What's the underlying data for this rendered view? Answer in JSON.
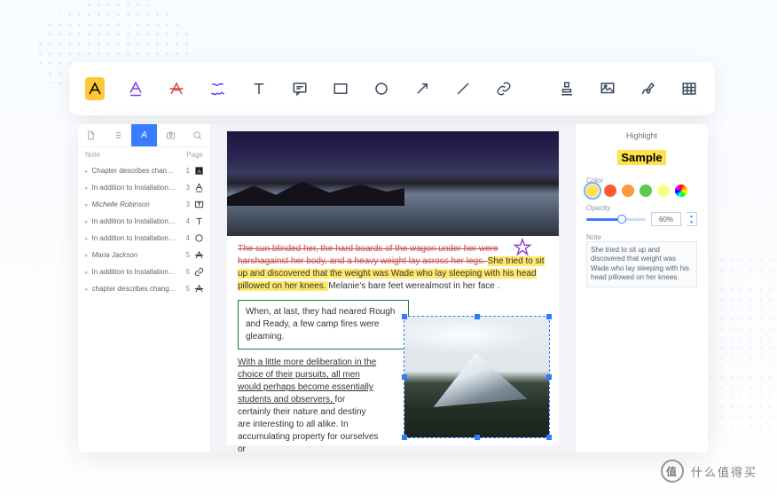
{
  "sidebar": {
    "header": {
      "note": "Note",
      "page": "Page"
    },
    "items": [
      {
        "text": "Chapter describes change Sho…",
        "page": "1",
        "icon": "highlight"
      },
      {
        "text": "In addition to Installation instru…",
        "page": "3",
        "icon": "underline"
      },
      {
        "text": "Michelle Robinson",
        "page": "3",
        "icon": "text-box",
        "em": true
      },
      {
        "text": "In addition to Installation instru…",
        "page": "4",
        "icon": "text"
      },
      {
        "text": "In addition to Installation instru…",
        "page": "4",
        "icon": "circle"
      },
      {
        "text": "Maria Jackson",
        "page": "5",
        "icon": "strike",
        "em": true
      },
      {
        "text": "In addition to Installation instru…",
        "page": "5",
        "icon": "link"
      },
      {
        "text": "chapter describes change Sho…",
        "page": "5",
        "icon": "strike"
      }
    ]
  },
  "document": {
    "struck": "The sun blinded her, the hard boards of the wagon under her were harshagainst her body, and a heavy weight lay across her legs. ",
    "highlighted": "She tried to sit up and discovered that the weight was Wade who lay sleeping with his head pillowed on her knees. ",
    "plain1": "Melanie's bare feet werealmost in her face .",
    "boxed": "When, at last, they had neared Rough and Ready, a few camp fires were gleaming.",
    "underlined": "With a little more deliberation in the choice of their pursuits, all men would perhaps become essentially students and observers, ",
    "plain2": "for certainly their nature and destiny are interesting to all alike. In accumulating property for ourselves or"
  },
  "panel": {
    "title": "Highlight",
    "sample": "Sample",
    "color_label": "Color",
    "colors": [
      "#ffe14d",
      "#ff5a36",
      "#ff9a3c",
      "#5ec94e",
      "#f7ff8a",
      "rainbow"
    ],
    "selected_color": 0,
    "opacity_label": "Opacity",
    "opacity_value": "60%",
    "note_label": "Note",
    "note_text": "She tried to sit up and discovered that weight was Wade who lay sleeping with his head pillowed on her knees."
  },
  "watermark": {
    "badge": "值",
    "text": "什么值得买"
  },
  "note_icons_svg": {
    "highlight": "<svg width='11' height='11' viewBox='0 0 24 24'><rect x='3' y='3' width='18' height='18' fill='#222'/><text x='12' y='17' font-size='14' fill='#fff' text-anchor='middle' font-family='serif'>A</text></svg>",
    "underline": "<svg width='11' height='11' viewBox='0 0 24 24' fill='none' stroke='#333' stroke-width='2'><path d='M4 18 L12 3 L20 18 M7 12 H17 M4 22 H20'/></svg>",
    "text-box": "<svg width='11' height='11' viewBox='0 0 24 24' fill='none' stroke='#333' stroke-width='2'><rect x='3' y='5' width='18' height='14'/><path d='M8 8h8M12 8v8'/></svg>",
    "text": "<svg width='11' height='11' viewBox='0 0 24 24' fill='none' stroke='#333' stroke-width='2'><path d='M5 5 H19 M12 5 V20'/></svg>",
    "circle": "<svg width='11' height='11' viewBox='0 0 24 24' fill='none' stroke='#333' stroke-width='2'><circle cx='12' cy='12' r='8'/></svg>",
    "strike": "<svg width='11' height='11' viewBox='0 0 24 24' fill='none' stroke='#333' stroke-width='2'><path d='M4 20 L12 4 L20 20 M7 14 H17 M2 12 H22'/></svg>",
    "link": "<svg width='11' height='11' viewBox='0 0 24 24' fill='none' stroke='#333' stroke-width='2'><path d='M10 14a5 5 0 0 0 7 0l3-3a5 5 0 0 0-7-7l-1 1 M14 10a5 5 0 0 0-7 0l-3 3a5 5 0 0 0 7 7l1-1'/></svg>"
  }
}
